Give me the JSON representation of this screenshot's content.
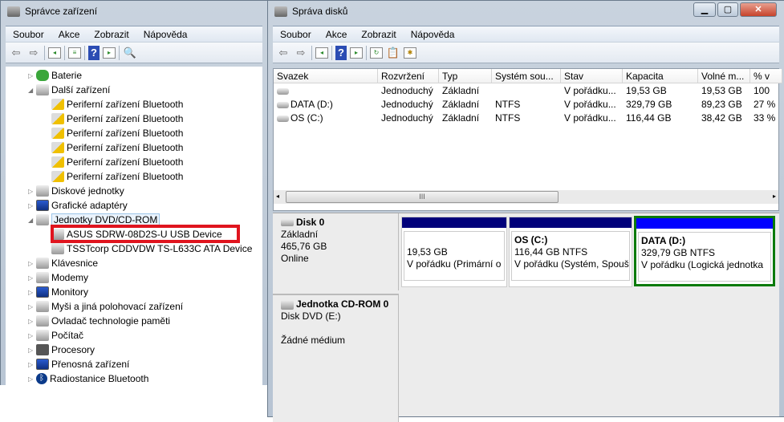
{
  "device_manager": {
    "title": "Správce zařízení",
    "menu": [
      "Soubor",
      "Akce",
      "Zobrazit",
      "Nápověda"
    ],
    "tree": [
      {
        "label": "Baterie",
        "level": 0,
        "expanded": false,
        "icon": "battery-icon"
      },
      {
        "label": "Další zařízení",
        "level": 0,
        "expanded": true,
        "icon": "unknown-device-icon"
      },
      {
        "label": "Periferní zařízení Bluetooth",
        "level": 1,
        "icon": "warning-device-icon"
      },
      {
        "label": "Periferní zařízení Bluetooth",
        "level": 1,
        "icon": "warning-device-icon"
      },
      {
        "label": "Periferní zařízení Bluetooth",
        "level": 1,
        "icon": "warning-device-icon"
      },
      {
        "label": "Periferní zařízení Bluetooth",
        "level": 1,
        "icon": "warning-device-icon"
      },
      {
        "label": "Periferní zařízení Bluetooth",
        "level": 1,
        "icon": "warning-device-icon"
      },
      {
        "label": "Periferní zařízení Bluetooth",
        "level": 1,
        "icon": "warning-device-icon"
      },
      {
        "label": "Diskové jednotky",
        "level": 0,
        "expanded": false,
        "icon": "disk-drive-icon"
      },
      {
        "label": "Grafické adaptéry",
        "level": 0,
        "expanded": false,
        "icon": "display-adapter-icon"
      },
      {
        "label": "Jednotky DVD/CD-ROM",
        "level": 0,
        "expanded": true,
        "icon": "dvd-drive-icon",
        "selected": true
      },
      {
        "label": "ASUS SDRW-08D2S-U USB Device",
        "level": 1,
        "icon": "dvd-drive-icon",
        "highlighted": true
      },
      {
        "label": "TSSTcorp CDDVDW TS-L633C ATA Device",
        "level": 1,
        "icon": "dvd-drive-icon"
      },
      {
        "label": "Klávesnice",
        "level": 0,
        "expanded": false,
        "icon": "keyboard-icon"
      },
      {
        "label": "Modemy",
        "level": 0,
        "expanded": false,
        "icon": "modem-icon"
      },
      {
        "label": "Monitory",
        "level": 0,
        "expanded": false,
        "icon": "monitor-icon"
      },
      {
        "label": "Myši a jiná polohovací zařízení",
        "level": 0,
        "expanded": false,
        "icon": "mouse-icon"
      },
      {
        "label": "Ovladač technologie paměti",
        "level": 0,
        "expanded": false,
        "icon": "memory-icon"
      },
      {
        "label": "Počítač",
        "level": 0,
        "expanded": false,
        "icon": "computer-icon"
      },
      {
        "label": "Procesory",
        "level": 0,
        "expanded": false,
        "icon": "processor-icon"
      },
      {
        "label": "Přenosná zařízení",
        "level": 0,
        "expanded": false,
        "icon": "portable-device-icon"
      },
      {
        "label": "Radiostanice Bluetooth",
        "level": 0,
        "expanded": false,
        "icon": "bluetooth-icon"
      }
    ]
  },
  "disk_management": {
    "title": "Správa disků",
    "menu": [
      "Soubor",
      "Akce",
      "Zobrazit",
      "Nápověda"
    ],
    "columns": [
      "Svazek",
      "Rozvržení",
      "Typ",
      "Systém sou...",
      "Stav",
      "Kapacita",
      "Volné m...",
      "% v"
    ],
    "rows": [
      [
        "",
        "Jednoduchý",
        "Základní",
        "",
        "V pořádku...",
        "19,53 GB",
        "19,53 GB",
        "100"
      ],
      [
        "DATA (D:)",
        "Jednoduchý",
        "Základní",
        "NTFS",
        "V pořádku...",
        "329,79 GB",
        "89,23 GB",
        "27 %"
      ],
      [
        "OS (C:)",
        "Jednoduchý",
        "Základní",
        "NTFS",
        "V pořádku...",
        "116,44 GB",
        "38,42 GB",
        "33 %"
      ]
    ],
    "disk0": {
      "name": "Disk 0",
      "type": "Základní",
      "size": "465,76 GB",
      "status": "Online",
      "partitions": [
        {
          "name": "",
          "size": "19,53 GB",
          "status": "V pořádku (Primární o"
        },
        {
          "name": "OS  (C:)",
          "size": "116,44 GB NTFS",
          "status": "V pořádku (Systém, Spoušt"
        },
        {
          "name": "DATA  (D:)",
          "size": "329,79 GB NTFS",
          "status": "V pořádku (Logická jednotka",
          "selected": true
        }
      ]
    },
    "cdrom0": {
      "name": "Jednotka CD-ROM 0",
      "type": "Disk DVD (E:)",
      "status": "Žádné médium"
    },
    "colors": {
      "primary_bar": "#00007a",
      "logical_bar": "#0000ff",
      "selection": "#0b7a0b"
    }
  }
}
